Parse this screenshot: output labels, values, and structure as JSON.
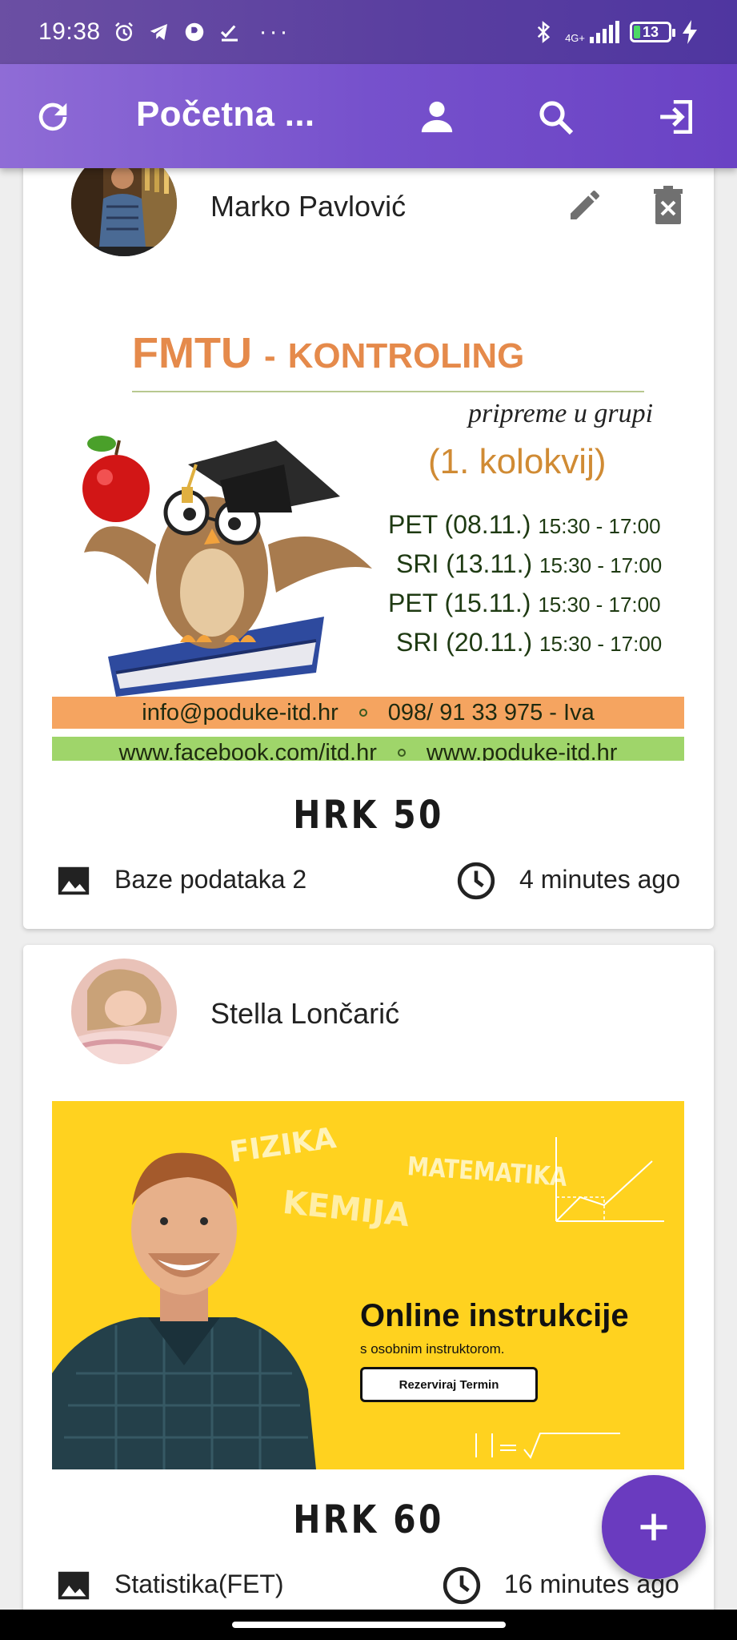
{
  "status_bar": {
    "time": "19:38",
    "signal_label": "4G+",
    "battery_level": "13",
    "icons": [
      "alarm-icon",
      "telegram-icon",
      "app-icon",
      "check-icon",
      "more-dots-icon",
      "bluetooth-icon",
      "signal-icon",
      "battery-icon",
      "charging-icon"
    ]
  },
  "app_bar": {
    "title": "Početna ...",
    "icons": [
      "refresh-icon",
      "person-icon",
      "search-icon",
      "logout-icon"
    ]
  },
  "posts": [
    {
      "author": "Marko Pavlović",
      "poster": {
        "title_main": "FMTU",
        "title_dash": "-",
        "title_rest": "KONTROLING",
        "subtitle": "pripreme u grupi",
        "kolokvij": "(1. kolokvij)",
        "sessions": [
          {
            "day": "PET (08.11.)",
            "time": "15:30 - 17:00"
          },
          {
            "day": "SRI (13.11.)",
            "time": "15:30 - 17:00"
          },
          {
            "day": "PET (15.11.)",
            "time": "15:30 - 17:00"
          },
          {
            "day": "SRI (20.11.)",
            "time": "15:30 - 17:00"
          }
        ],
        "email": "info@poduke-itd.hr",
        "phone": "098/ 91 33 975 - Iva",
        "facebook": "www.facebook.com/itd.hr",
        "website": "www.poduke-itd.hr"
      },
      "price": "HRK 50",
      "subject": "Baze podataka 2",
      "time_ago": "4 minutes ago"
    },
    {
      "author": "Stella Lončarić",
      "poster": {
        "words": [
          "FIZIKA",
          "MATEMATIKA",
          "KEMIJA"
        ],
        "headline": "Online instrukcije",
        "sub": "s osobnim instruktorom.",
        "button": "Rezerviraj Termin"
      },
      "price": "HRK 60",
      "subject": "Statistika(FET)",
      "time_ago": "16 minutes ago"
    }
  ],
  "fab": {
    "icon": "add-icon"
  },
  "colors": {
    "app_bar": "#7651cc",
    "status_bar": "#5a3fa0",
    "fab": "#6a3bbf",
    "poster_orange": "#f5a460",
    "poster_green": "#9fd56a",
    "poster_yellow": "#ffd21f"
  }
}
